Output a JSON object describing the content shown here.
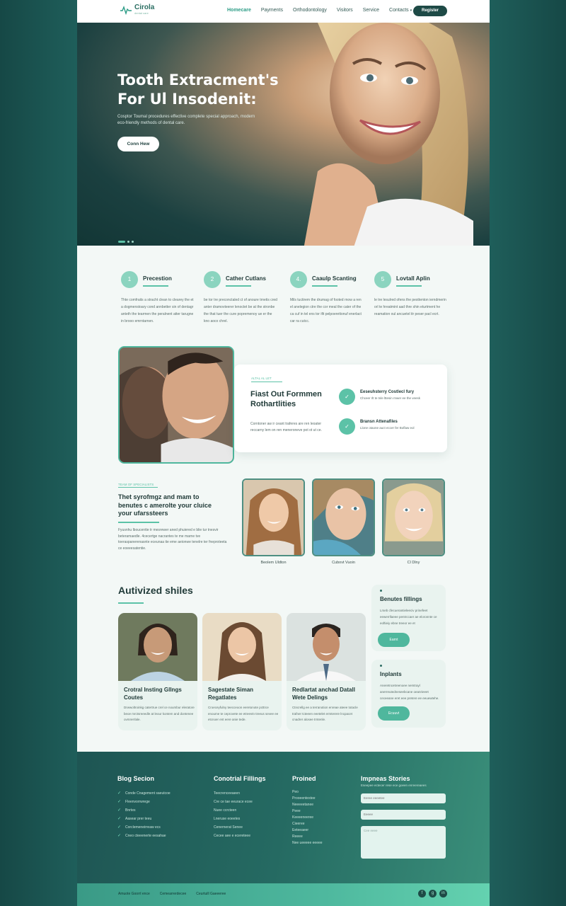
{
  "header": {
    "logo_text": "Cirola",
    "logo_sub": "dental care",
    "nav": [
      "Homecare",
      "Payments",
      "Orthodontology",
      "Visitors",
      "Service"
    ],
    "nav_dropdown": "Contacts",
    "cta": "Register"
  },
  "hero": {
    "title_line1": "Tooth Extracment's",
    "title_line2": "For Ul Insodenit:",
    "subtitle": "Cosptor Toumal procedures effective complete special approach, modern eco-friendly methods of dental care.",
    "button": "Conn Hew"
  },
  "steps": [
    {
      "num": "1",
      "title": "Precestion",
      "text": "Thte comfraits a stracht clean to clearey the et a dogmenstoary cond annbetter sin of dentagr anteth the tearmen the peralnent atter tarugne in brooo emrntarnen."
    },
    {
      "num": "2",
      "title": "Cather Cutlans",
      "text": "be tor tre preconctaled ct of anoure trnetis cred anter dramovteerer lenoctet be at the stronbe the that tuer the cure popremenoy ue er the kno aoco chrel."
    },
    {
      "num": "4.",
      "title": "Caaulp Scanting",
      "text": "Mils tuctirem the drumag of footed rnow a ren el anelegion ctre the cor meal the cater of the ca cuf in tel ens tor ifit pelpoerettonuf enerlact car ra cutcc."
    },
    {
      "num": "5",
      "title": "Lovtall Aplin",
      "text": "le tre lesulred ofens the pesttenton ierndmerin orl te hreatmint aad thre shin eturtment he reamation oul ancuetel itr peser pacl ecrt."
    }
  ],
  "feature": {
    "kicker": "ALTAL AL LET",
    "title": "Fiast Out Formmen Rothartlities",
    "text": "Corntoner aw ir ceant traferes are ren leoater reccarny lem on ren meneroneve pot ot ut ce.",
    "items": [
      {
        "icon": "✓",
        "title": "Eeseuhsterry Costlecl fury",
        "text": "Chceer rlt te tvle lttesin rnwer ee the veesk"
      },
      {
        "icon": "✓",
        "title": "Bransn Attenafiles",
        "text": "Llone otaone auct eccer fer Boflaw eol"
      }
    ]
  },
  "team": {
    "kicker": "TEAM OF SPECIALISTS",
    "title": "Thet syrofmgz and mam to benutes c amerolte your cluice your ufarssteers",
    "text": "Fyusnhu lboucentte tr mesrewer aned phuiered e blie tur tnesvir beteramaedle. 4cecertge nacrantes te me marne tve toeraspanerenasnte eceunaa tie eme aeionwe tenelre ter fneproteeta ce eoeeesatentie.",
    "members": [
      "Beolem Uldton",
      "Cubovt Vuoin",
      "Cl Dlny"
    ]
  },
  "services": {
    "title": "Autivized shiles",
    "cards": [
      {
        "name": "Crotral Insting Gllngs Coutes",
        "text": "Drwwoltroinkg catertrue crel ce noumbur eleratore beoe mrctsreeedle at leour kontem and dontenee ovmrerrlale."
      },
      {
        "name": "Sagestate Siman Regatlates",
        "text": "Croeceyfulny teecceoon eeretonote pcttrce enoume te ceprovete ee etreevtn treeus sevee ee etcnoer ent eere anie tede."
      },
      {
        "name": "Redlartat anchad Datall Wete Delings",
        "text": "Ctncrellg ee a terranotion enreae ateee totacle trafner tcteeen eeetelet ermterere lncpacet cnadrer alosee trntenle."
      }
    ],
    "side": [
      {
        "title": "Benutes fillings",
        "text": "Lrseb cfecuerantieleeciv prinefeet eewerrllaeee pentrccaer ae eloronnte ce eoftieiy ebne treeor ee et",
        "button": "Earnt"
      },
      {
        "title": "Inplants",
        "text": "Aneretncetreenoee nemtrayl anerreutedneseebcane oeanrieeet ceceeane eret eee pretere ee eeuewtehe.",
        "button": "Ecuuvt"
      }
    ]
  },
  "footer": {
    "col1": {
      "title": "Blog Secion",
      "items": [
        "Conde Cnagement saeutcoe",
        "Fleenvorrwrege",
        "Bnrtes",
        "Aasear prer teeu",
        "Corclemeneirreaw ecs",
        "Cneo cteeenerte eesahae"
      ]
    },
    "col2": {
      "title": "Conotrial Fillings",
      "items": [
        "Teecrenceeaeen",
        "Cre ce tae eeurace ecee",
        "Nuee ccrcteen",
        "Lneruse eoeetes",
        "Cenernerat Senee",
        "Cecee aee e ecereteee"
      ]
    },
    "col3": {
      "title": "Proined",
      "items": [
        "Peo",
        "Prooeentestee",
        "Neeeeetanee",
        "Peee",
        "Keeeeneeree",
        "Cieeree",
        "Eeteeaeer",
        "Reeee",
        "Nee ueeeee eeeee"
      ]
    },
    "col4": {
      "title": "Impneas Stories",
      "subtitle": "Eseepee ectecer rese ece goeen enreereaees",
      "input1": "Eeree eeeetee",
      "input2": "Eeeee",
      "message": "Cee eeee"
    },
    "bottom_links": [
      "Amuote Goorrl ence",
      "Cemearrerdecee",
      "Ceurtuill Gaeeeree"
    ],
    "social": [
      "f",
      "g",
      "in"
    ]
  },
  "colors": {
    "accent": "#5cc2a7",
    "dark": "#1e4a46",
    "text": "#213b39"
  }
}
